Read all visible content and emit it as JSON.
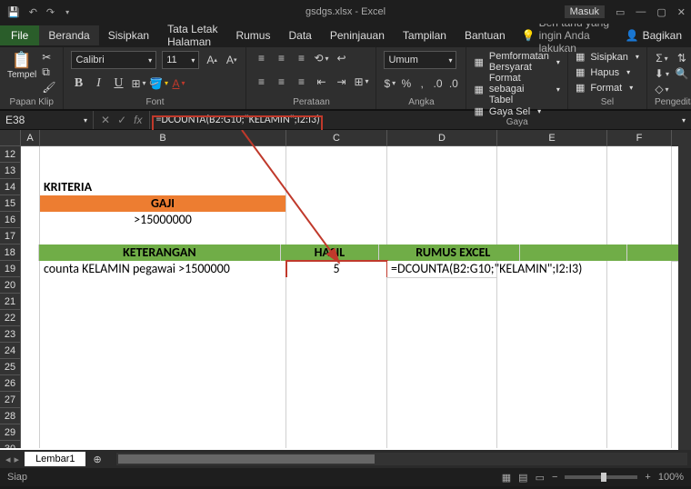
{
  "titlebar": {
    "title": "gsdgs.xlsx - Excel",
    "masuk": "Masuk"
  },
  "menutabs": {
    "file": "File",
    "beranda": "Beranda",
    "sisipkan": "Sisipkan",
    "tataletak": "Tata Letak Halaman",
    "rumus": "Rumus",
    "data": "Data",
    "peninjauan": "Peninjauan",
    "tampilan": "Tampilan",
    "bantuan": "Bantuan",
    "tellme": "Beri tahu yang ingin Anda lakukan",
    "bagikan": "Bagikan"
  },
  "ribbon": {
    "tempel": "Tempel",
    "papanklip": "Papan Klip",
    "font_name": "Calibri",
    "font_size": "11",
    "font": "Font",
    "perataan": "Perataan",
    "umum": "Umum",
    "angka": "Angka",
    "pemformatan": "Pemformatan Bersyarat",
    "formattabel": "Format sebagai Tabel",
    "gayasel": "Gaya Sel",
    "gaya": "Gaya",
    "sisipkan": "Sisipkan",
    "hapus": "Hapus",
    "format": "Format",
    "sel": "Sel",
    "pengeditan": "Pengeditan"
  },
  "fxbar": {
    "cellref": "E38",
    "fx": "fx",
    "formula": "=DCOUNTA(B2:G10;\"KELAMIN\";I2:I3)"
  },
  "cols": {
    "a": "A",
    "b": "B",
    "c": "C",
    "d": "D",
    "e": "E",
    "f": "F"
  },
  "rows_start": 12,
  "cells": {
    "b14": "KRITERIA",
    "b15": "GAJI",
    "b16": ">15000000",
    "b18": "KETERANGAN",
    "c18": "HASIL",
    "d18": "RUMUS EXCEL",
    "b19": "counta KELAMIN pegawai >1500000",
    "c19": "5",
    "d19": "=DCOUNTA(B2:G10;\"KELAMIN\";I2:I3)"
  },
  "sheet_tab": "Lembar1",
  "status": {
    "siap": "Siap",
    "zoom": "100%"
  }
}
